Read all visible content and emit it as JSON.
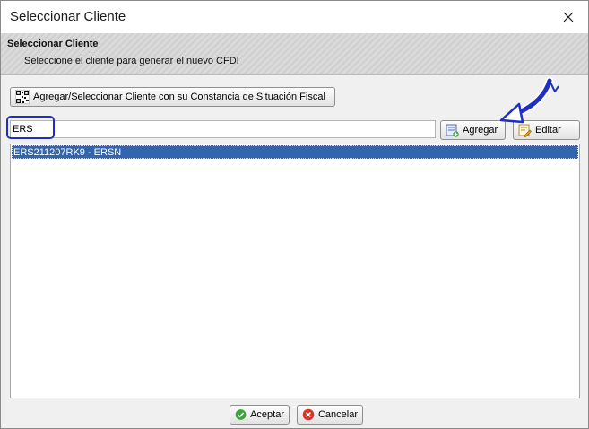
{
  "window": {
    "title": "Seleccionar Cliente"
  },
  "header": {
    "title": "Seleccionar Cliente",
    "subtitle": "Seleccione el cliente para generar el nuevo CFDI"
  },
  "toolbar": {
    "csf_button_label": "Agregar/Seleccionar Cliente con su Constancia de Situación Fiscal",
    "add_label": "Agregar",
    "edit_label": "Editar"
  },
  "search": {
    "value": "ERS"
  },
  "client_list": {
    "items": [
      {
        "label": "ERS211207RK9 - ERSN",
        "selected": true
      }
    ]
  },
  "footer": {
    "accept_label": "Aceptar",
    "cancel_label": "Cancelar"
  },
  "colors": {
    "selection": "#3166ae",
    "highlight": "#1f2fc4",
    "accept_icon": "#3aa53a",
    "cancel_icon": "#d9342b"
  },
  "icons": {
    "close": "close-icon",
    "csf": "qr-code-icon",
    "add": "add-record-icon",
    "edit": "edit-record-icon",
    "accept": "check-circle-icon",
    "cancel": "x-circle-icon"
  }
}
